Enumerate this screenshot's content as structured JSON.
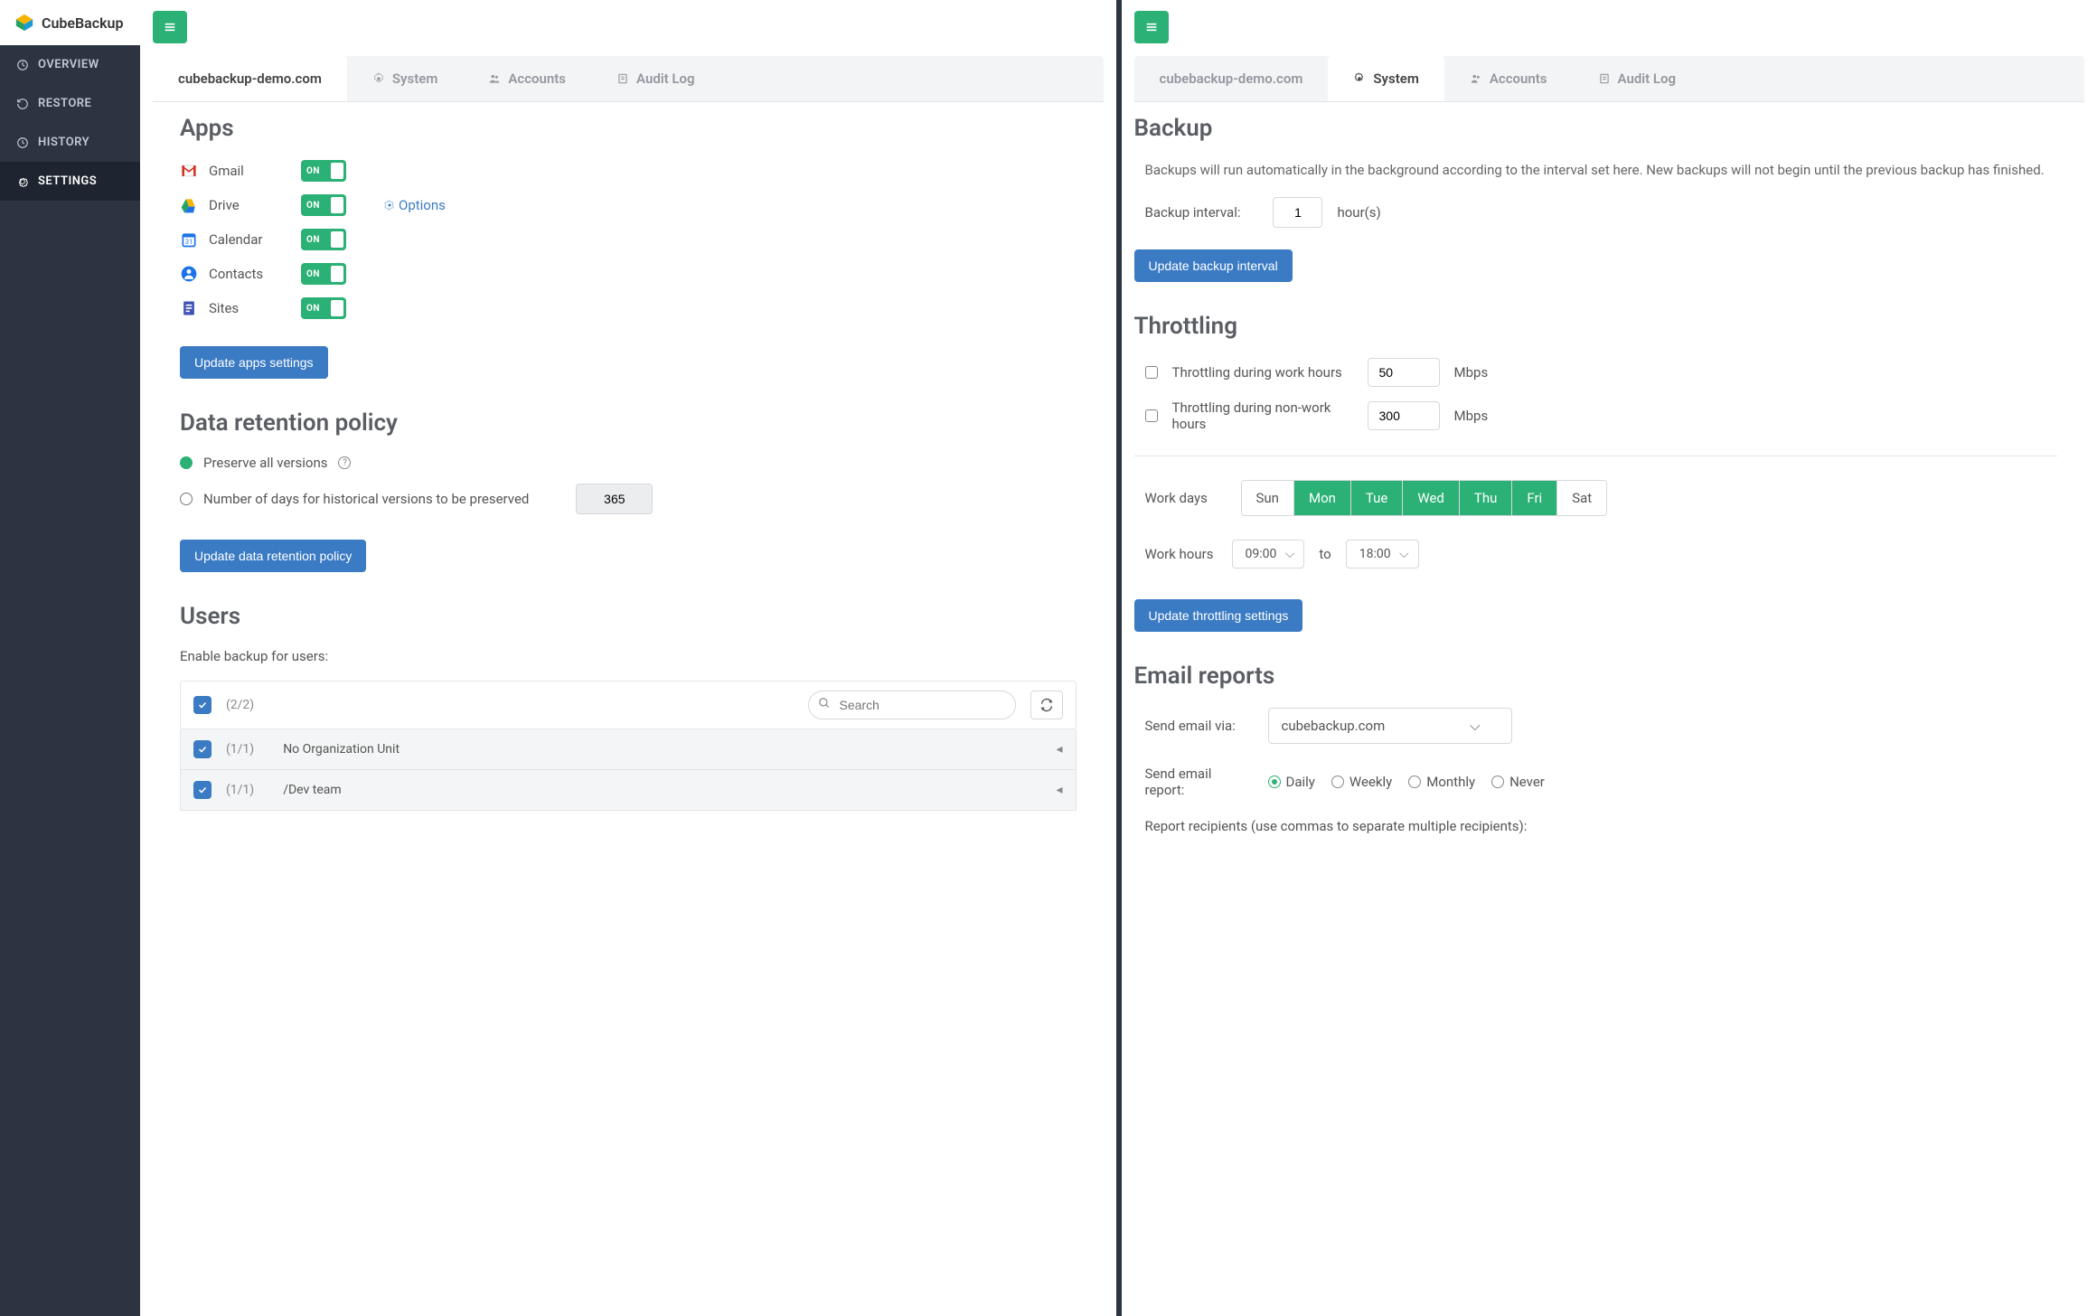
{
  "brand": "CubeBackup",
  "nav": [
    {
      "label": "OVERVIEW"
    },
    {
      "label": "RESTORE"
    },
    {
      "label": "HISTORY"
    },
    {
      "label": "SETTINGS"
    }
  ],
  "left": {
    "tabs": [
      {
        "label": "cubebackup-demo.com"
      },
      {
        "label": "System"
      },
      {
        "label": "Accounts"
      },
      {
        "label": "Audit Log"
      }
    ],
    "apps_heading": "Apps",
    "apps": [
      {
        "name": "Gmail",
        "on_label": "ON"
      },
      {
        "name": "Drive",
        "on_label": "ON"
      },
      {
        "name": "Calendar",
        "on_label": "ON"
      },
      {
        "name": "Contacts",
        "on_label": "ON"
      },
      {
        "name": "Sites",
        "on_label": "ON"
      }
    ],
    "options_link": "Options",
    "update_apps_btn": "Update apps settings",
    "retention_heading": "Data retention policy",
    "retention_opt1": "Preserve all versions",
    "retention_opt2": "Number of days for historical versions to be preserved",
    "retention_days": "365",
    "update_retention_btn": "Update data retention policy",
    "users_heading": "Users",
    "users_sub": "Enable backup for users:",
    "users_count_top": "(2/2)",
    "search_placeholder": "Search",
    "user_rows": [
      {
        "count": "(1/1)",
        "name": "No Organization Unit"
      },
      {
        "count": "(1/1)",
        "name": "/Dev team"
      }
    ]
  },
  "right": {
    "tabs": [
      {
        "label": "cubebackup-demo.com"
      },
      {
        "label": "System"
      },
      {
        "label": "Accounts"
      },
      {
        "label": "Audit Log"
      }
    ],
    "backup_heading": "Backup",
    "backup_desc": "Backups will run automatically in the background according to the interval set here. New backups will not begin until the previous backup has finished.",
    "backup_interval_label": "Backup interval:",
    "backup_interval_value": "1",
    "backup_interval_unit": "hour(s)",
    "update_interval_btn": "Update backup interval",
    "throttling_heading": "Throttling",
    "throttle_work_label": "Throttling during work hours",
    "throttle_work_val": "50",
    "throttle_nonwork_label": "Throttling during non-work hours",
    "throttle_nonwork_val": "300",
    "mbps": "Mbps",
    "workdays_label": "Work days",
    "days": [
      {
        "label": "Sun",
        "active": false
      },
      {
        "label": "Mon",
        "active": true
      },
      {
        "label": "Tue",
        "active": true
      },
      {
        "label": "Wed",
        "active": true
      },
      {
        "label": "Thu",
        "active": true
      },
      {
        "label": "Fri",
        "active": true
      },
      {
        "label": "Sat",
        "active": false
      }
    ],
    "workhours_label": "Work hours",
    "workhours_from": "09:00",
    "workhours_to_label": "to",
    "workhours_to": "18:00",
    "update_throttle_btn": "Update throttling settings",
    "email_heading": "Email reports",
    "email_via_label": "Send email via:",
    "email_via_value": "cubebackup.com",
    "email_report_label": "Send email report:",
    "email_freq": [
      {
        "label": "Daily",
        "sel": true
      },
      {
        "label": "Weekly",
        "sel": false
      },
      {
        "label": "Monthly",
        "sel": false
      },
      {
        "label": "Never",
        "sel": false
      }
    ],
    "recipients_label": "Report recipients (use commas to separate multiple recipients):"
  }
}
